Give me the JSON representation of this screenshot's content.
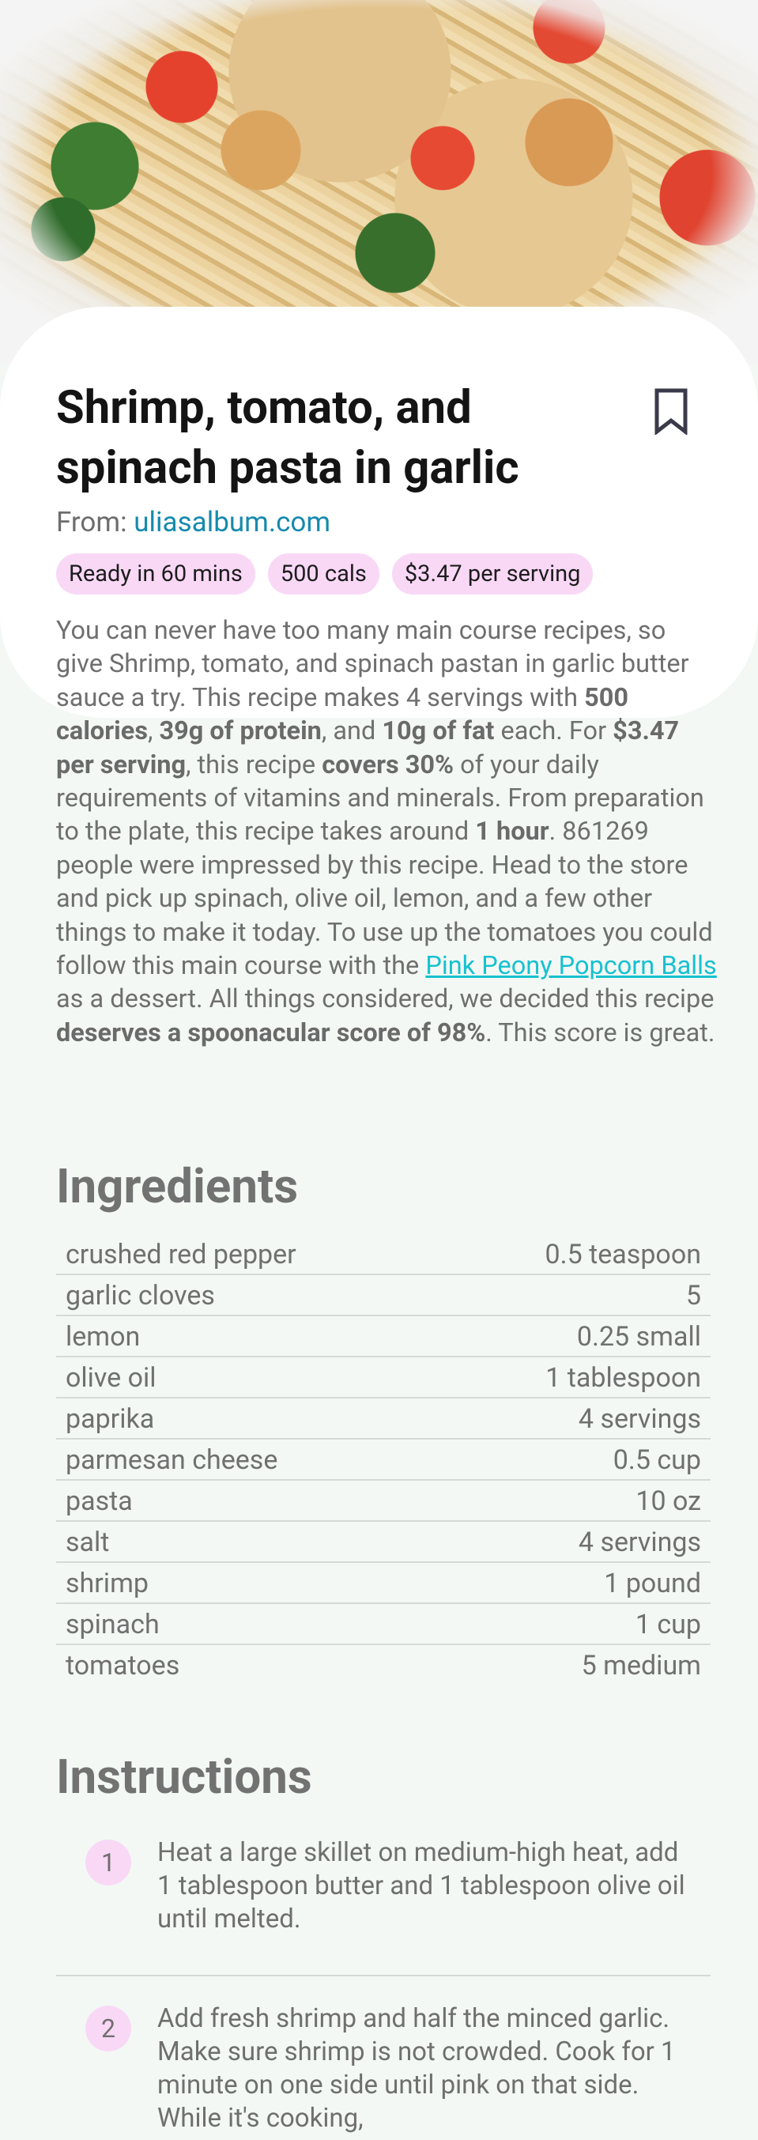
{
  "recipe": {
    "title": "Shrimp, tomato, and spinach pasta in garlic",
    "source_prefix": "From: ",
    "source_name": "uliasalbum.com",
    "badges": {
      "ready": "Ready in 60 mins",
      "calories": "500 cals",
      "price": "$3.47 per serving"
    }
  },
  "summary": {
    "s1": "You can never have too many main course recipes, so give Shrimp, tomato, and spinach pastan in garlic butter sauce a try. This recipe makes 4 servings with ",
    "b1": "500 calories",
    "s2": ", ",
    "b2": "39g of protein",
    "s3": ", and ",
    "b3": "10g of fat",
    "s4": " each. For ",
    "b4": "$3.47 per serving",
    "s5": ", this recipe ",
    "b5": "covers 30%",
    "s6": " of your daily requirements of vitamins and minerals. From preparation to the plate, this recipe takes around ",
    "b6": "1 hour",
    "s7": ". 861269 people were impressed by this recipe. Head to the store and pick up spinach, olive oil, lemon, and a few other things to make it today. To use up the tomatoes you could follow this main course with the ",
    "link": "Pink Peony Popcorn Balls",
    "s8": " as a dessert. All things considered, we decided this recipe ",
    "b7": "deserves a spoonacular score of 98%",
    "s9": ". This score is great."
  },
  "ingredients": {
    "heading": "Ingredients",
    "items": [
      {
        "name": "crushed red pepper",
        "amount": "0.5 teaspoon"
      },
      {
        "name": "garlic cloves",
        "amount": "5"
      },
      {
        "name": "lemon",
        "amount": "0.25 small"
      },
      {
        "name": "olive oil",
        "amount": "1 tablespoon"
      },
      {
        "name": "paprika",
        "amount": "4 servings"
      },
      {
        "name": "parmesan cheese",
        "amount": "0.5 cup"
      },
      {
        "name": "pasta",
        "amount": "10 oz"
      },
      {
        "name": "salt",
        "amount": "4 servings"
      },
      {
        "name": "shrimp",
        "amount": "1 pound"
      },
      {
        "name": "spinach",
        "amount": "1 cup"
      },
      {
        "name": "tomatoes",
        "amount": "5 medium"
      }
    ]
  },
  "instructions": {
    "heading": "Instructions",
    "steps": [
      {
        "number": "1",
        "text": "Heat a large skillet on medium-high heat, add 1 tablespoon butter and 1 tablespoon olive oil until melted."
      },
      {
        "number": "2",
        "text": "Add fresh shrimp and half the minced garlic. Make sure shrimp is not crowded. Cook for 1 minute on one side until pink on that side. While it's cooking,"
      }
    ]
  },
  "icons": {
    "bookmark": "bookmark-outline-icon"
  },
  "colors": {
    "chip": "#f9d8f6",
    "source_link": "#168aad",
    "recipe_link": "#17c1cf",
    "background": "#f3f8f5"
  }
}
